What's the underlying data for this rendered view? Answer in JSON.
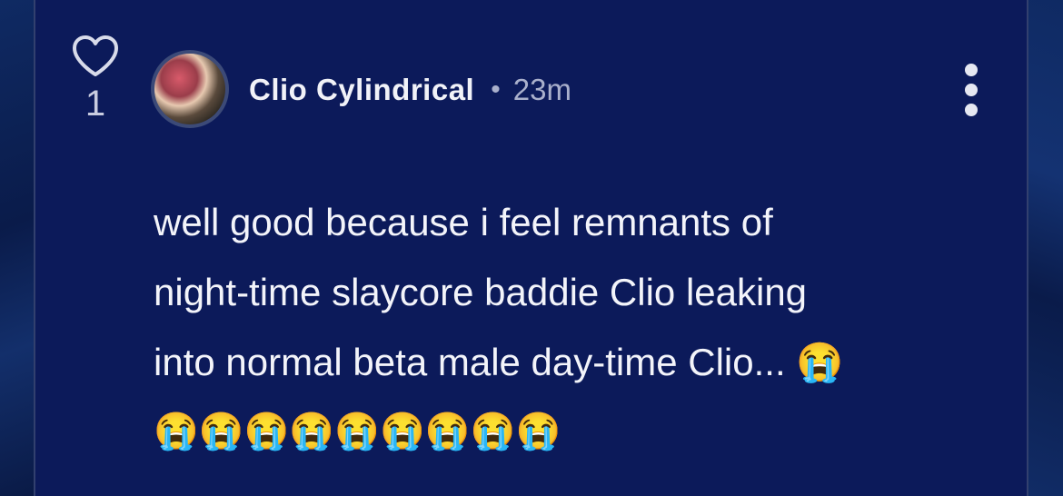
{
  "post": {
    "likes": "1",
    "author": "Clio Cylindrical",
    "separator": "•",
    "time": "23m",
    "message_lines": [
      "well good because i feel remnants of",
      "night-time slaycore baddie Clio leaking",
      "into normal beta male day-time Clio... 😭",
      "😭😭😭😭😭😭😭😭😭"
    ]
  },
  "icons": {
    "like": "heart-icon",
    "more": "more-vertical-icon"
  },
  "colors": {
    "background": "#0c1a5a",
    "text": "#f3f4fa",
    "muted": "#aab0cc"
  }
}
